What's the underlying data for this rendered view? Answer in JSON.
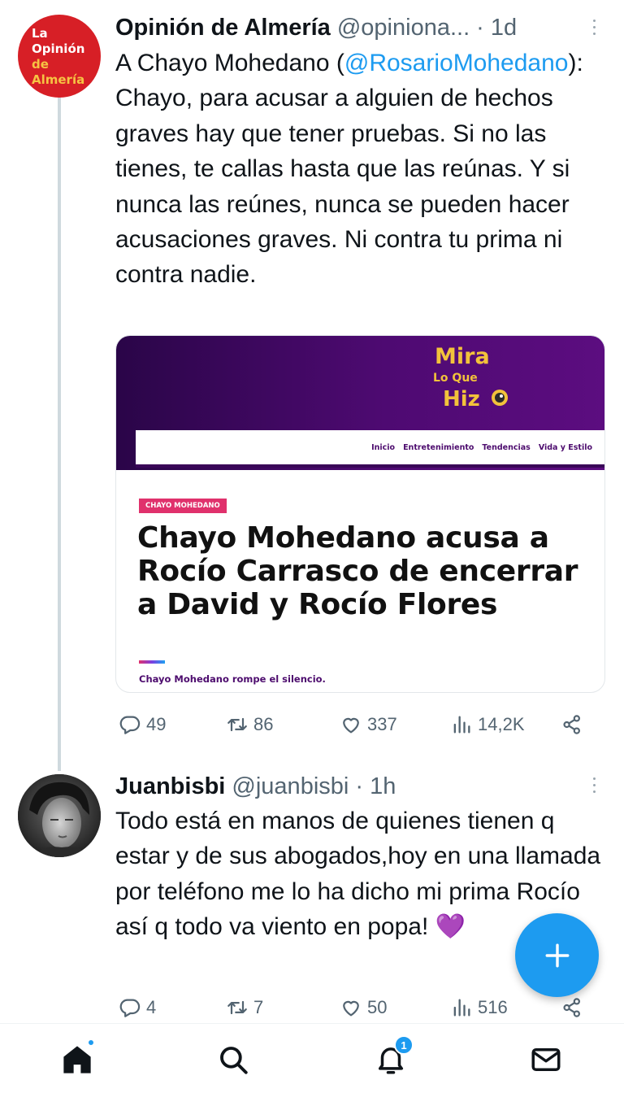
{
  "tweet1": {
    "avatar_text": [
      "La",
      "Opinión",
      "de",
      "Almería"
    ],
    "display_name": "Opinión de Almería",
    "meta": "@opiniona... · 1d",
    "text_part1": "A Chayo Mohedano (",
    "mention": "@RosarioMohedano",
    "text_part2": "): Chayo, para acusar a alguien de hechos graves hay que tener pruebas. Si no las tienes, te callas hasta que las reúnas. Y si nunca las reúnes, nunca se pueden hacer acusaciones graves. Ni contra tu prima ni contra nadie.",
    "card": {
      "logo_lines": [
        "Mira",
        "Lo Que",
        "Hiz"
      ],
      "nav_items": [
        "Inicio",
        "Entretenimiento",
        "Tendencias",
        "Vida y Estilo"
      ],
      "tag": "CHAYO MOHEDANO",
      "headline": "Chayo Mohedano acusa a Rocío Carrasco de encerrar a David y Rocío Flores",
      "subtitle": "Chayo Mohedano rompe el silencio."
    },
    "stats": {
      "replies": "49",
      "retweets": "86",
      "likes": "337",
      "views": "14,2K"
    }
  },
  "tweet2": {
    "display_name": "Juanbisbi",
    "meta": "@juanbisbi · 1h",
    "text": "Todo está en manos de quienes tienen q estar y de sus abogados,hoy en una llamada por teléfono me lo ha dicho mi prima Rocío así q todo va viento en popa! 💜",
    "stats": {
      "replies": "4",
      "retweets": "7",
      "likes": "50",
      "views": "516"
    }
  },
  "nav": {
    "notifications_badge": "1"
  },
  "colors": {
    "accent": "#1d9bf0",
    "brand_red": "#d71f26",
    "card_purple": "#4e0a72",
    "tag_pink": "#e0316c"
  }
}
